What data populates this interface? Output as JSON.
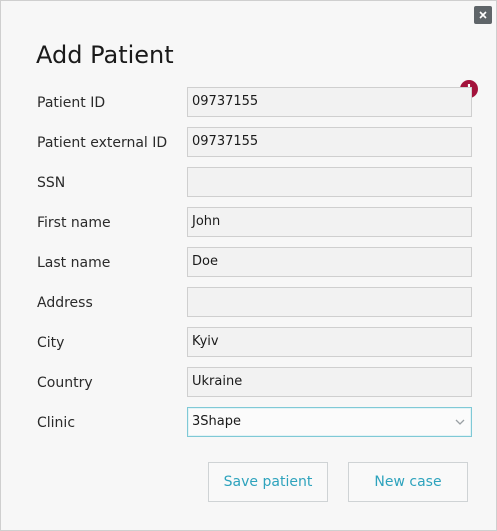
{
  "dialog": {
    "title": "Add Patient",
    "close_icon": "close-icon",
    "error_icon": "error-icon",
    "error_symbol": "!"
  },
  "fields": [
    {
      "key": "patient_id",
      "label": "Patient ID",
      "value": "09737155"
    },
    {
      "key": "patient_external_id",
      "label": "Patient external ID",
      "value": "09737155"
    },
    {
      "key": "ssn",
      "label": "SSN",
      "value": ""
    },
    {
      "key": "first_name",
      "label": "First name",
      "value": "John"
    },
    {
      "key": "last_name",
      "label": "Last name",
      "value": "Doe"
    },
    {
      "key": "address",
      "label": "Address",
      "value": ""
    },
    {
      "key": "city",
      "label": "City",
      "value": "Kyiv"
    },
    {
      "key": "country",
      "label": "Country",
      "value": "Ukraine"
    },
    {
      "key": "clinic",
      "label": "Clinic",
      "value": "3Shape"
    }
  ],
  "buttons": {
    "save_patient": "Save patient",
    "new_case": "New case"
  },
  "colors": {
    "accent": "#2ea3bd",
    "error": "#a3133c",
    "close_bg": "#5f6569"
  }
}
